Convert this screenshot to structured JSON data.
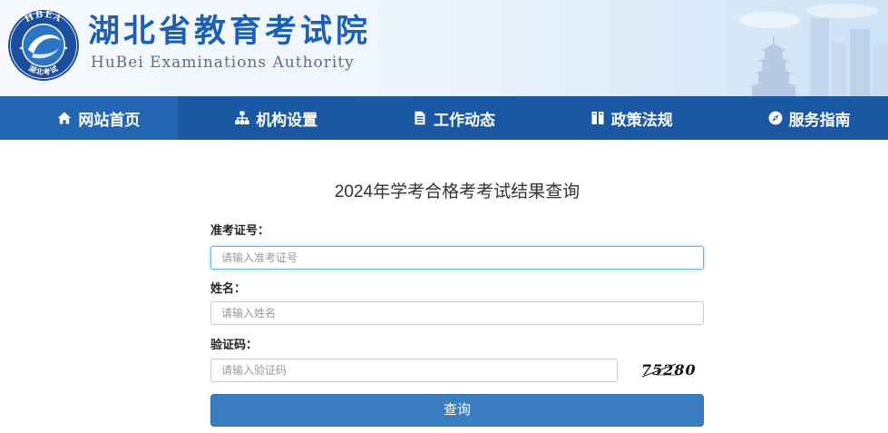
{
  "header": {
    "title": "湖北省教育考试院",
    "subtitle": "HuBei Examinations Authority",
    "logo": {
      "ring_text_top": "HBEA",
      "ring_text_bottom": "湖北考试"
    }
  },
  "nav": {
    "items": [
      {
        "label": "网站首页",
        "icon": "home-icon",
        "active": true
      },
      {
        "label": "机构设置",
        "icon": "sitemap-icon",
        "active": false
      },
      {
        "label": "工作动态",
        "icon": "file-icon",
        "active": false
      },
      {
        "label": "政策法规",
        "icon": "book-icon",
        "active": false
      },
      {
        "label": "服务指南",
        "icon": "compass-icon",
        "active": false
      }
    ]
  },
  "main": {
    "title": "2024年学考合格考考试结果查询",
    "form": {
      "fields": [
        {
          "label": "准考证号：",
          "placeholder": "请输入准考证号",
          "value": "",
          "focused": true
        },
        {
          "label": "姓名：",
          "placeholder": "请输入姓名",
          "value": "",
          "focused": false
        },
        {
          "label": "验证码：",
          "placeholder": "请输入验证码",
          "value": "",
          "focused": false
        }
      ],
      "captcha_text": "75280",
      "submit_label": "查询"
    }
  },
  "colors": {
    "brand_title": "#1d5fb4",
    "nav_background": "#1b58a3",
    "nav_active": "#2366b2",
    "button": "#3a7dc1",
    "focus_border": "#66afe9"
  }
}
